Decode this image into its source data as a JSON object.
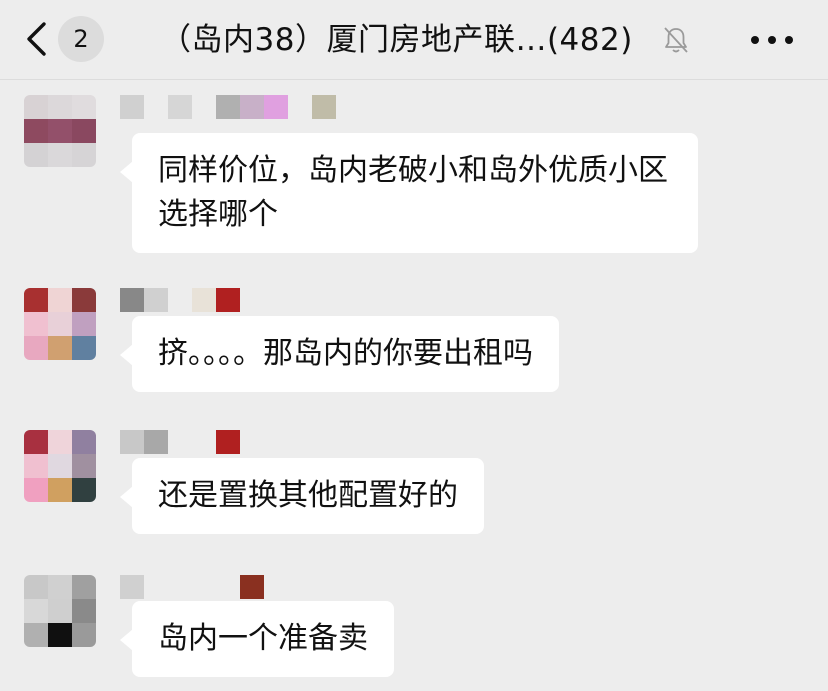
{
  "header": {
    "unread_count": "2",
    "title": "（岛内38）厦门房地产联…(482)"
  },
  "messages": [
    {
      "text": "同样价位，岛内老破小和岛外优质小区选择哪个"
    },
    {
      "text": "挤。。。。那岛内的你要出租吗"
    },
    {
      "text": "还是置换其他配置好的"
    },
    {
      "text": "岛内一个准备卖"
    }
  ]
}
